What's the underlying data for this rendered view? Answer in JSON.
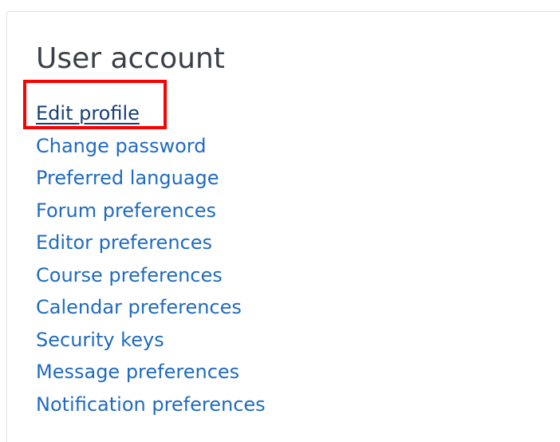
{
  "section": {
    "title": "User account"
  },
  "links": [
    {
      "label": "Edit profile"
    },
    {
      "label": "Change password"
    },
    {
      "label": "Preferred language"
    },
    {
      "label": "Forum preferences"
    },
    {
      "label": "Editor preferences"
    },
    {
      "label": "Course preferences"
    },
    {
      "label": "Calendar preferences"
    },
    {
      "label": "Security keys"
    },
    {
      "label": "Message preferences"
    },
    {
      "label": "Notification preferences"
    }
  ],
  "colors": {
    "link": "#1f6bbf",
    "link_active": "#163f77",
    "highlight": "#ff0000",
    "title": "#3a4048"
  }
}
